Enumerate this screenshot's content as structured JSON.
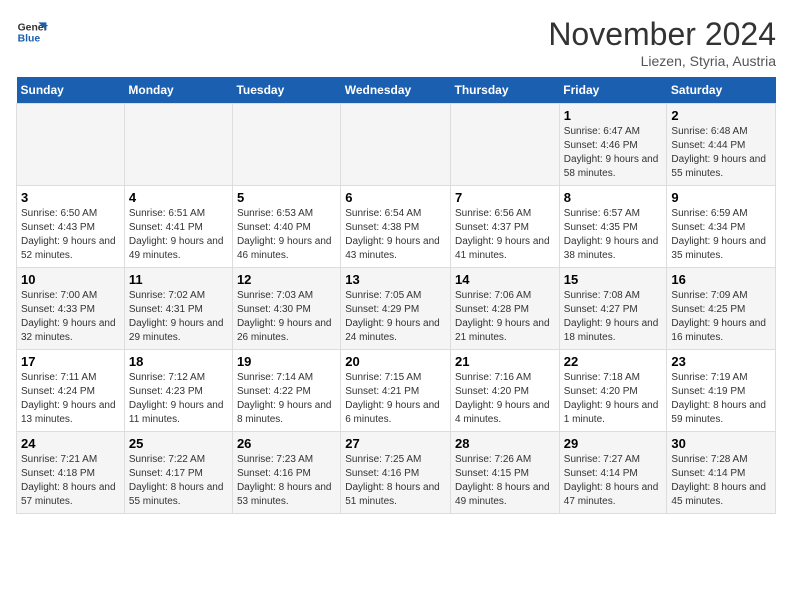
{
  "logo": {
    "line1": "General",
    "line2": "Blue"
  },
  "title": "November 2024",
  "subtitle": "Liezen, Styria, Austria",
  "weekdays": [
    "Sunday",
    "Monday",
    "Tuesday",
    "Wednesday",
    "Thursday",
    "Friday",
    "Saturday"
  ],
  "weeks": [
    [
      {
        "day": "",
        "info": ""
      },
      {
        "day": "",
        "info": ""
      },
      {
        "day": "",
        "info": ""
      },
      {
        "day": "",
        "info": ""
      },
      {
        "day": "",
        "info": ""
      },
      {
        "day": "1",
        "info": "Sunrise: 6:47 AM\nSunset: 4:46 PM\nDaylight: 9 hours and 58 minutes."
      },
      {
        "day": "2",
        "info": "Sunrise: 6:48 AM\nSunset: 4:44 PM\nDaylight: 9 hours and 55 minutes."
      }
    ],
    [
      {
        "day": "3",
        "info": "Sunrise: 6:50 AM\nSunset: 4:43 PM\nDaylight: 9 hours and 52 minutes."
      },
      {
        "day": "4",
        "info": "Sunrise: 6:51 AM\nSunset: 4:41 PM\nDaylight: 9 hours and 49 minutes."
      },
      {
        "day": "5",
        "info": "Sunrise: 6:53 AM\nSunset: 4:40 PM\nDaylight: 9 hours and 46 minutes."
      },
      {
        "day": "6",
        "info": "Sunrise: 6:54 AM\nSunset: 4:38 PM\nDaylight: 9 hours and 43 minutes."
      },
      {
        "day": "7",
        "info": "Sunrise: 6:56 AM\nSunset: 4:37 PM\nDaylight: 9 hours and 41 minutes."
      },
      {
        "day": "8",
        "info": "Sunrise: 6:57 AM\nSunset: 4:35 PM\nDaylight: 9 hours and 38 minutes."
      },
      {
        "day": "9",
        "info": "Sunrise: 6:59 AM\nSunset: 4:34 PM\nDaylight: 9 hours and 35 minutes."
      }
    ],
    [
      {
        "day": "10",
        "info": "Sunrise: 7:00 AM\nSunset: 4:33 PM\nDaylight: 9 hours and 32 minutes."
      },
      {
        "day": "11",
        "info": "Sunrise: 7:02 AM\nSunset: 4:31 PM\nDaylight: 9 hours and 29 minutes."
      },
      {
        "day": "12",
        "info": "Sunrise: 7:03 AM\nSunset: 4:30 PM\nDaylight: 9 hours and 26 minutes."
      },
      {
        "day": "13",
        "info": "Sunrise: 7:05 AM\nSunset: 4:29 PM\nDaylight: 9 hours and 24 minutes."
      },
      {
        "day": "14",
        "info": "Sunrise: 7:06 AM\nSunset: 4:28 PM\nDaylight: 9 hours and 21 minutes."
      },
      {
        "day": "15",
        "info": "Sunrise: 7:08 AM\nSunset: 4:27 PM\nDaylight: 9 hours and 18 minutes."
      },
      {
        "day": "16",
        "info": "Sunrise: 7:09 AM\nSunset: 4:25 PM\nDaylight: 9 hours and 16 minutes."
      }
    ],
    [
      {
        "day": "17",
        "info": "Sunrise: 7:11 AM\nSunset: 4:24 PM\nDaylight: 9 hours and 13 minutes."
      },
      {
        "day": "18",
        "info": "Sunrise: 7:12 AM\nSunset: 4:23 PM\nDaylight: 9 hours and 11 minutes."
      },
      {
        "day": "19",
        "info": "Sunrise: 7:14 AM\nSunset: 4:22 PM\nDaylight: 9 hours and 8 minutes."
      },
      {
        "day": "20",
        "info": "Sunrise: 7:15 AM\nSunset: 4:21 PM\nDaylight: 9 hours and 6 minutes."
      },
      {
        "day": "21",
        "info": "Sunrise: 7:16 AM\nSunset: 4:20 PM\nDaylight: 9 hours and 4 minutes."
      },
      {
        "day": "22",
        "info": "Sunrise: 7:18 AM\nSunset: 4:20 PM\nDaylight: 9 hours and 1 minute."
      },
      {
        "day": "23",
        "info": "Sunrise: 7:19 AM\nSunset: 4:19 PM\nDaylight: 8 hours and 59 minutes."
      }
    ],
    [
      {
        "day": "24",
        "info": "Sunrise: 7:21 AM\nSunset: 4:18 PM\nDaylight: 8 hours and 57 minutes."
      },
      {
        "day": "25",
        "info": "Sunrise: 7:22 AM\nSunset: 4:17 PM\nDaylight: 8 hours and 55 minutes."
      },
      {
        "day": "26",
        "info": "Sunrise: 7:23 AM\nSunset: 4:16 PM\nDaylight: 8 hours and 53 minutes."
      },
      {
        "day": "27",
        "info": "Sunrise: 7:25 AM\nSunset: 4:16 PM\nDaylight: 8 hours and 51 minutes."
      },
      {
        "day": "28",
        "info": "Sunrise: 7:26 AM\nSunset: 4:15 PM\nDaylight: 8 hours and 49 minutes."
      },
      {
        "day": "29",
        "info": "Sunrise: 7:27 AM\nSunset: 4:14 PM\nDaylight: 8 hours and 47 minutes."
      },
      {
        "day": "30",
        "info": "Sunrise: 7:28 AM\nSunset: 4:14 PM\nDaylight: 8 hours and 45 minutes."
      }
    ]
  ]
}
